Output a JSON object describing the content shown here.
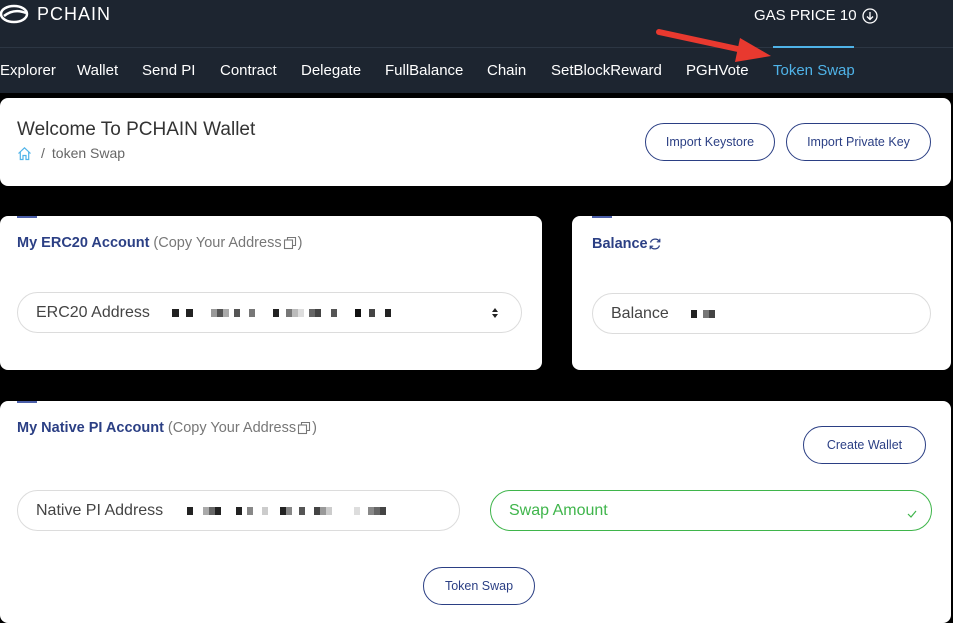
{
  "header": {
    "logo_text": "PCHAIN",
    "gas_label": "GAS PRICE 10"
  },
  "nav": {
    "items": [
      {
        "label": "Explorer",
        "active": false
      },
      {
        "label": "Wallet",
        "active": false
      },
      {
        "label": "Send PI",
        "active": false
      },
      {
        "label": "Contract",
        "active": false
      },
      {
        "label": "Delegate",
        "active": false
      },
      {
        "label": "FullBalance",
        "active": false
      },
      {
        "label": "Chain",
        "active": false
      },
      {
        "label": "SetBlockReward",
        "active": false
      },
      {
        "label": "PGHVote",
        "active": false
      },
      {
        "label": "Token Swap",
        "active": true
      }
    ],
    "active_color": "#4fb3e8"
  },
  "welcome": {
    "title": "Welcome To PCHAIN Wallet",
    "breadcrumb_sep": "/",
    "breadcrumb_current": "token Swap",
    "import_keystore": "Import Keystore",
    "import_private_key": "Import Private Key"
  },
  "erc20": {
    "title": "My ERC20 Account",
    "copy_hint_open": "(Copy Your Address",
    "copy_hint_close": ")",
    "field_label": "ERC20 Address"
  },
  "balance": {
    "title": "Balance",
    "field_label": "Balance"
  },
  "native": {
    "title": "My Native PI Account",
    "copy_hint_open": "(Copy Your Address",
    "copy_hint_close": ")",
    "create_wallet": "Create Wallet",
    "field_label": "Native PI Address",
    "swap_placeholder": "Swap Amount",
    "token_swap_button": "Token Swap"
  },
  "colors": {
    "primary": "#2b3f84",
    "valid_green": "#3fb54b",
    "annotation_arrow": "#e8392f"
  }
}
